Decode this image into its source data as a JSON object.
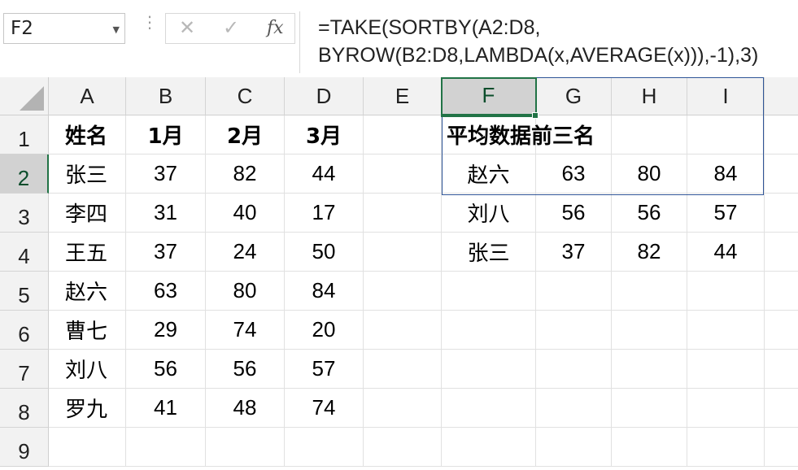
{
  "name_box": {
    "value": "F2"
  },
  "formula_bar": {
    "cancel_icon": "✕",
    "enter_icon": "✓",
    "fx_label": "fx",
    "formula_line1": "=TAKE(SORTBY(A2:D8,",
    "formula_line2": "BYROW(B2:D8,LAMBDA(x,AVERAGE(x))),-1),3)"
  },
  "columns": [
    "A",
    "B",
    "C",
    "D",
    "E",
    "F",
    "G",
    "H",
    "I"
  ],
  "rows": [
    "1",
    "2",
    "3",
    "4",
    "5",
    "6",
    "7",
    "8",
    "9"
  ],
  "selected_cell": "F2",
  "source_table": {
    "headers": [
      "姓名",
      "1月",
      "2月",
      "3月"
    ],
    "rows": [
      [
        "张三",
        "37",
        "82",
        "44"
      ],
      [
        "李四",
        "31",
        "40",
        "17"
      ],
      [
        "王五",
        "37",
        "24",
        "50"
      ],
      [
        "赵六",
        "63",
        "80",
        "84"
      ],
      [
        "曹七",
        "29",
        "74",
        "20"
      ],
      [
        "刘八",
        "56",
        "56",
        "57"
      ],
      [
        "罗九",
        "41",
        "48",
        "74"
      ]
    ]
  },
  "result_table": {
    "title": "平均数据前三名",
    "rows": [
      [
        "赵六",
        "63",
        "80",
        "84"
      ],
      [
        "刘八",
        "56",
        "56",
        "57"
      ],
      [
        "张三",
        "37",
        "82",
        "44"
      ]
    ]
  },
  "colors": {
    "selection_green": "#217346",
    "result_border": "#2f5597",
    "header_bg": "#f2f2f2"
  }
}
